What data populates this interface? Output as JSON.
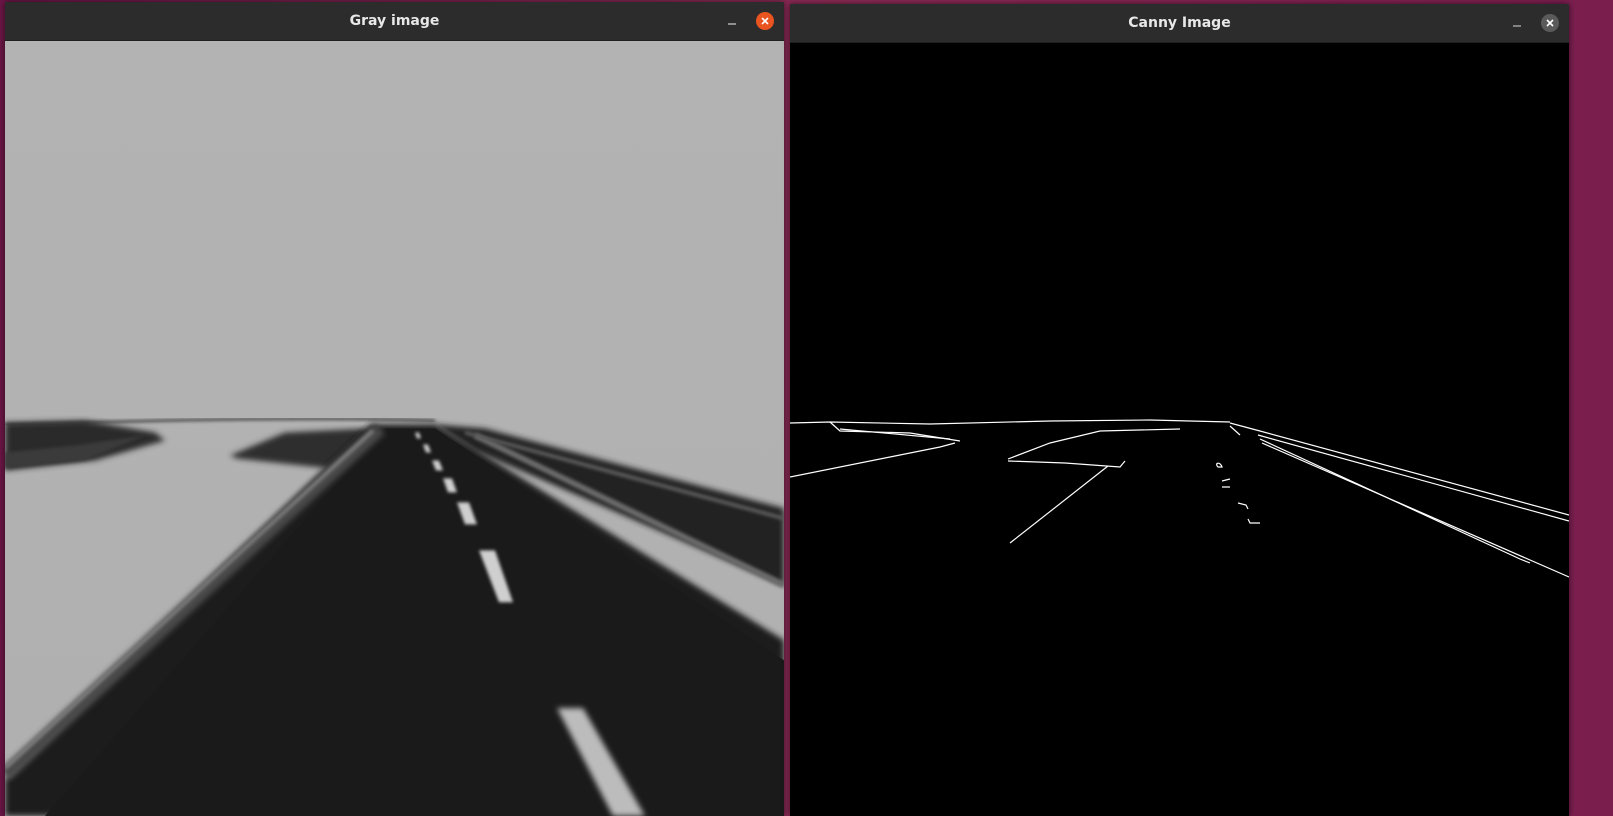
{
  "windows": [
    {
      "id": "gray",
      "title": "Gray image",
      "close_color": "#e95420",
      "active": true
    },
    {
      "id": "canny",
      "title": "Canny Image",
      "close_color": "#5a5a5a",
      "active": false
    }
  ],
  "icons": {
    "minimize": "minimize-icon",
    "close": "close-icon"
  },
  "colors": {
    "sky_gray": "#b2b2b2",
    "road_dark": "#1c1c1c",
    "edge_white": "#ffffff",
    "canvas_black": "#000000"
  }
}
